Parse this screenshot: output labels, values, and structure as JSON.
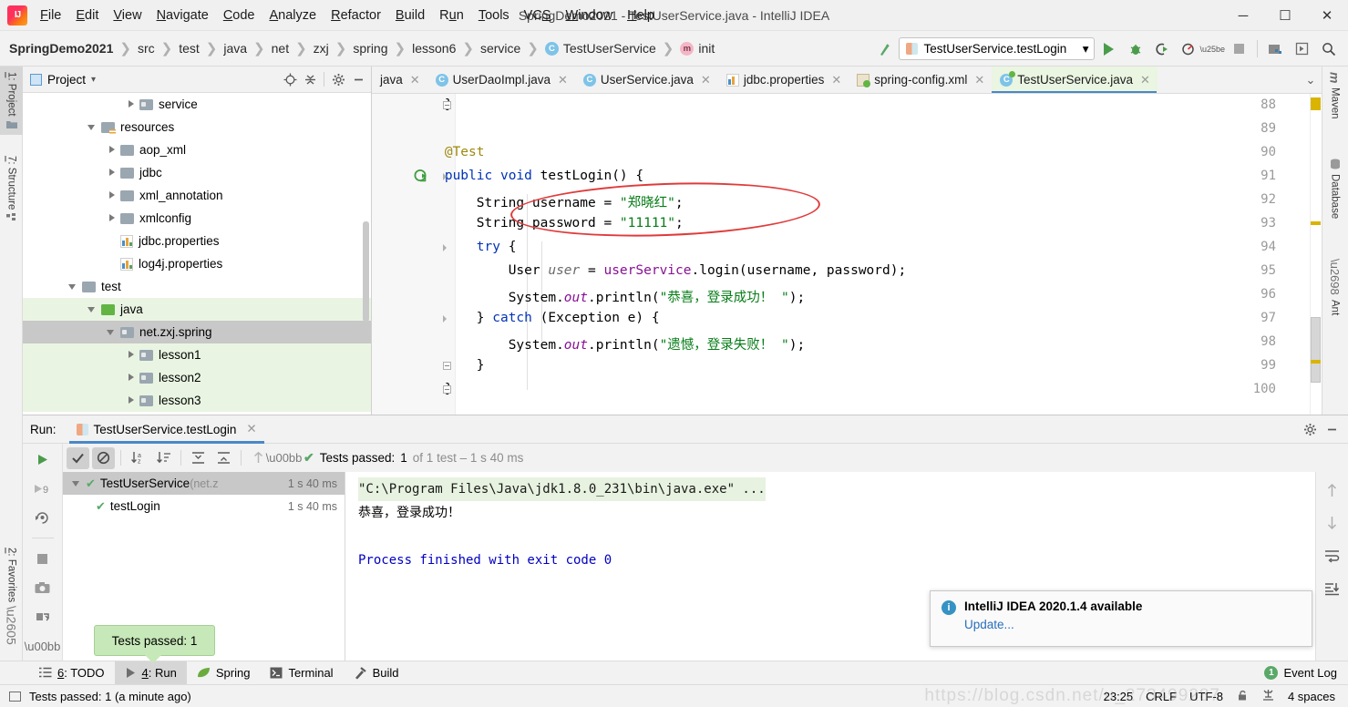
{
  "window": {
    "title": "SpringDemo2021 - TestUserService.java - IntelliJ IDEA",
    "minimize": "─",
    "maximize": "☐",
    "close": "✕"
  },
  "menu": [
    {
      "label": "File",
      "mnemonic": "F"
    },
    {
      "label": "Edit",
      "mnemonic": "E"
    },
    {
      "label": "View",
      "mnemonic": "V"
    },
    {
      "label": "Navigate",
      "mnemonic": "N"
    },
    {
      "label": "Code",
      "mnemonic": "C"
    },
    {
      "label": "Analyze",
      "mnemonic": "A"
    },
    {
      "label": "Refactor",
      "mnemonic": "R"
    },
    {
      "label": "Build",
      "mnemonic": "B"
    },
    {
      "label": "Run",
      "mnemonic": "u"
    },
    {
      "label": "Tools",
      "mnemonic": "T"
    },
    {
      "label": "VCS",
      "mnemonic": "S"
    },
    {
      "label": "Window",
      "mnemonic": "W"
    },
    {
      "label": "Help",
      "mnemonic": "H"
    }
  ],
  "breadcrumb": [
    {
      "label": "SpringDemo2021",
      "icon": null
    },
    {
      "label": "src",
      "icon": null
    },
    {
      "label": "test",
      "icon": null
    },
    {
      "label": "java",
      "icon": null
    },
    {
      "label": "net",
      "icon": null
    },
    {
      "label": "zxj",
      "icon": null
    },
    {
      "label": "spring",
      "icon": null
    },
    {
      "label": "lesson6",
      "icon": null
    },
    {
      "label": "service",
      "icon": null
    },
    {
      "label": "TestUserService",
      "icon": "class-icon",
      "icon_letter": "C"
    },
    {
      "label": "init",
      "icon": "method-icon",
      "icon_letter": "m"
    }
  ],
  "toolbar": {
    "run_configuration": "TestUserService.testLogin",
    "dropdown_arrow": "▾",
    "buttons": [
      {
        "name": "run-button",
        "glyph": "▶"
      },
      {
        "name": "debug-button",
        "glyph": "🐞"
      },
      {
        "name": "run-with-coverage-button",
        "glyph": "▶"
      },
      {
        "name": "profile-button",
        "glyph": "◔"
      },
      {
        "name": "stop-button",
        "glyph": "■"
      },
      {
        "name": "update-project-button",
        "glyph": "⬛"
      },
      {
        "name": "open-in-browser-button",
        "glyph": "▣"
      },
      {
        "name": "search-everywhere-button",
        "glyph": "🔍"
      }
    ]
  },
  "left_tool_tabs": [
    {
      "label": "1: Project",
      "mnemonic": "1",
      "selected": true,
      "icon": "folder-icon"
    },
    {
      "label": "7: Structure",
      "mnemonic": "7",
      "selected": false,
      "icon": "structure-icon"
    },
    {
      "label": "2: Favorites",
      "mnemonic": "2",
      "selected": false,
      "icon": "star-icon"
    }
  ],
  "right_tool_tabs": [
    {
      "label": "Maven",
      "icon": "maven-icon"
    },
    {
      "label": "Database",
      "icon": "database-icon"
    },
    {
      "label": "Ant",
      "icon": "ant-icon"
    }
  ],
  "project_panel": {
    "title": "Project",
    "dropdown": "▾",
    "actions": [
      {
        "name": "locate-file-icon",
        "glyph": "⊕"
      },
      {
        "name": "collapse-all-icon",
        "glyph": "⩵"
      },
      {
        "name": "settings-gear-icon",
        "glyph": "⚙"
      },
      {
        "name": "hide-panel-icon",
        "glyph": "─"
      }
    ],
    "tree": [
      {
        "label": "service",
        "indent": 5,
        "arrow": "closed",
        "icon": "package-folder",
        "hl": "none"
      },
      {
        "label": "resources",
        "indent": 3,
        "arrow": "open",
        "icon": "resources-folder",
        "hl": "none"
      },
      {
        "label": "aop_xml",
        "indent": 4,
        "arrow": "closed",
        "icon": "folder",
        "hl": "none"
      },
      {
        "label": "jdbc",
        "indent": 4,
        "arrow": "closed",
        "icon": "folder",
        "hl": "none"
      },
      {
        "label": "xml_annotation",
        "indent": 4,
        "arrow": "closed",
        "icon": "folder",
        "hl": "none"
      },
      {
        "label": "xmlconfig",
        "indent": 4,
        "arrow": "closed",
        "icon": "folder",
        "hl": "none"
      },
      {
        "label": "jdbc.properties",
        "indent": 4,
        "arrow": "none",
        "icon": "properties-file",
        "hl": "none"
      },
      {
        "label": "log4j.properties",
        "indent": 4,
        "arrow": "none",
        "icon": "properties-file",
        "hl": "none"
      },
      {
        "label": "test",
        "indent": 2,
        "arrow": "open",
        "icon": "folder",
        "hl": "none"
      },
      {
        "label": "java",
        "indent": 3,
        "arrow": "open",
        "icon": "source-folder-green",
        "hl": "green"
      },
      {
        "label": "net.zxj.spring",
        "indent": 4,
        "arrow": "open",
        "icon": "package-folder",
        "hl": "selected"
      },
      {
        "label": "lesson1",
        "indent": 5,
        "arrow": "closed",
        "icon": "package-folder",
        "hl": "green"
      },
      {
        "label": "lesson2",
        "indent": 5,
        "arrow": "closed",
        "icon": "package-folder",
        "hl": "green"
      },
      {
        "label": "lesson3",
        "indent": 5,
        "arrow": "closed",
        "icon": "package-folder",
        "hl": "green"
      }
    ]
  },
  "editor_tabs": [
    {
      "label": "java",
      "icon": "file-icon",
      "active": false,
      "close": "✕"
    },
    {
      "label": "UserDaoImpl.java",
      "icon": "class-icon",
      "active": false,
      "close": "✕"
    },
    {
      "label": "UserService.java",
      "icon": "class-icon",
      "active": false,
      "close": "✕"
    },
    {
      "label": "jdbc.properties",
      "icon": "properties-icon",
      "active": false,
      "close": "✕"
    },
    {
      "label": "spring-config.xml",
      "icon": "xml-icon",
      "active": false,
      "close": "✕"
    },
    {
      "label": "TestUserService.java",
      "icon": "test-class-icon",
      "active": true,
      "close": "✕"
    }
  ],
  "editor_tabs_overflow": "⌄",
  "code": {
    "first_line": 88,
    "lines": [
      {
        "num": 88,
        "indent": 2,
        "tokens": [
          {
            "t": "}",
            "c": "p"
          }
        ]
      },
      {
        "num": 89,
        "indent": 0,
        "tokens": []
      },
      {
        "num": 90,
        "indent": 2,
        "tokens": [
          {
            "t": "@Test",
            "c": "an"
          }
        ]
      },
      {
        "num": 91,
        "indent": 2,
        "tokens": [
          {
            "t": "public",
            "c": "k"
          },
          {
            "t": " ",
            "c": "p"
          },
          {
            "t": "void",
            "c": "k"
          },
          {
            "t": " testLogin() {",
            "c": "p"
          }
        ]
      },
      {
        "num": 92,
        "indent": 3,
        "tokens": [
          {
            "t": "String username = ",
            "c": "p"
          },
          {
            "t": "\"郑晓红\"",
            "c": "s"
          },
          {
            "t": ";",
            "c": "p"
          }
        ]
      },
      {
        "num": 93,
        "indent": 3,
        "tokens": [
          {
            "t": "String password = ",
            "c": "p"
          },
          {
            "t": "\"11111\"",
            "c": "s"
          },
          {
            "t": ";",
            "c": "p"
          }
        ]
      },
      {
        "num": 94,
        "indent": 3,
        "tokens": [
          {
            "t": "try",
            "c": "k"
          },
          {
            "t": " {",
            "c": "p"
          }
        ]
      },
      {
        "num": 95,
        "indent": 4,
        "tokens": [
          {
            "t": "User ",
            "c": "p"
          },
          {
            "t": "user",
            "c": "lv"
          },
          {
            "t": " = ",
            "c": "p"
          },
          {
            "t": "userService",
            "c": "f"
          },
          {
            "t": ".login(username, password);",
            "c": "p"
          }
        ]
      },
      {
        "num": 96,
        "indent": 4,
        "tokens": [
          {
            "t": "System.",
            "c": "p"
          },
          {
            "t": "out",
            "c": "fld"
          },
          {
            "t": ".println(",
            "c": "p"
          },
          {
            "t": "\"恭喜，登录成功！ \"",
            "c": "s"
          },
          {
            "t": ");",
            "c": "p"
          }
        ]
      },
      {
        "num": 97,
        "indent": 3,
        "tokens": [
          {
            "t": "} ",
            "c": "p"
          },
          {
            "t": "catch",
            "c": "k"
          },
          {
            "t": " (Exception e) {",
            "c": "p"
          }
        ]
      },
      {
        "num": 98,
        "indent": 4,
        "tokens": [
          {
            "t": "System.",
            "c": "p"
          },
          {
            "t": "out",
            "c": "fld"
          },
          {
            "t": ".println(",
            "c": "p"
          },
          {
            "t": "\"遗憾，登录失败！ \"",
            "c": "s"
          },
          {
            "t": ");",
            "c": "p"
          }
        ]
      },
      {
        "num": 99,
        "indent": 3,
        "tokens": [
          {
            "t": "}",
            "c": "p"
          }
        ]
      },
      {
        "num": 100,
        "indent": 2,
        "tokens": [
          {
            "t": "}",
            "c": "p"
          }
        ]
      }
    ],
    "annotation": {
      "type": "red-ellipse",
      "covers_lines": [
        92,
        93
      ]
    }
  },
  "run_window": {
    "label": "Run:",
    "tab": "TestUserService.testLogin",
    "tab_close": "✕",
    "header_actions": [
      {
        "name": "settings-gear-icon",
        "glyph": "⚙"
      },
      {
        "name": "hide-panel-icon",
        "glyph": "─"
      }
    ],
    "gutter_buttons": [
      {
        "name": "rerun-button",
        "glyph": "▶"
      },
      {
        "name": "rerun-failed-tests-button",
        "glyph": "▶9"
      },
      {
        "name": "toggle-auto-test-button",
        "glyph": "↺"
      },
      {
        "name": "stop-button",
        "glyph": "■"
      },
      {
        "name": "export-test-results-button",
        "glyph": "📷"
      },
      {
        "name": "import-test-results-button",
        "glyph": "⚙"
      },
      {
        "name": "more-actions-button",
        "glyph": "»"
      }
    ],
    "test_toolbar": [
      {
        "name": "show-passed-toggle",
        "glyph": "✓",
        "on": true
      },
      {
        "name": "show-ignored-toggle",
        "glyph": "⊘",
        "on": true
      },
      {
        "name": "sort-alphabetically-button",
        "glyph": "↓a₂",
        "on": false
      },
      {
        "name": "sort-by-duration-button",
        "glyph": "↓≡",
        "on": false
      },
      {
        "name": "expand-all-button",
        "glyph": "⤒",
        "on": false
      },
      {
        "name": "collapse-all-button",
        "glyph": "⤓",
        "on": false
      },
      {
        "name": "previous-occurrence-button",
        "glyph": "↑",
        "on": false
      },
      {
        "name": "more-button",
        "glyph": "»",
        "on": false
      }
    ],
    "status": {
      "check": "✔",
      "label": "Tests passed:",
      "count": "1",
      "detail": "of 1 test – 1 s 40 ms"
    },
    "test_tree": [
      {
        "label": "TestUserService",
        "package": "(net.z",
        "time": "1 s 40 ms",
        "indent": 0,
        "selected": true,
        "arrow": "open"
      },
      {
        "label": "testLogin",
        "package": "",
        "time": "1 s 40 ms",
        "indent": 1,
        "selected": false,
        "arrow": "none"
      }
    ],
    "console": [
      {
        "text": "\"C:\\Program Files\\Java\\jdk1.8.0_231\\bin\\java.exe\" ...",
        "style": "cmd"
      },
      {
        "text": "恭喜，登录成功！",
        "style": "plain"
      },
      {
        "text": "",
        "style": "plain"
      },
      {
        "text": "Process finished with exit code 0",
        "style": "exit"
      }
    ],
    "console_side_buttons": [
      {
        "name": "scroll-up-button",
        "glyph": "↑"
      },
      {
        "name": "scroll-down-button",
        "glyph": "↓"
      },
      {
        "name": "soft-wrap-button",
        "glyph": "↵"
      },
      {
        "name": "scroll-to-end-button",
        "glyph": "⤓"
      }
    ]
  },
  "notification": {
    "icon": "info-icon",
    "title": "IntelliJ IDEA 2020.1.4 available",
    "link": "Update..."
  },
  "tooltip": {
    "text": "Tests passed: 1"
  },
  "bottom_tabs": [
    {
      "label": "6: TODO",
      "mnemonic": "6",
      "icon": "todo-icon",
      "selected": false
    },
    {
      "label": "4: Run",
      "mnemonic": "4",
      "icon": "run-icon",
      "selected": true
    },
    {
      "label": "Spring",
      "mnemonic": "",
      "icon": "spring-leaf-icon",
      "selected": false
    },
    {
      "label": "Terminal",
      "mnemonic": "",
      "icon": "terminal-icon",
      "selected": false
    },
    {
      "label": "Build",
      "mnemonic": "",
      "icon": "hammer-icon",
      "selected": false
    }
  ],
  "event_log": {
    "badge": "1",
    "label": "Event Log"
  },
  "statusbar": {
    "message": "Tests passed: 1 (a minute ago)",
    "time": "23:25",
    "line_separator": "CRLF",
    "encoding": "UTF-8",
    "lock_icon": "🔓",
    "branch_icon": "⚒",
    "indent": "4 spaces",
    "watermark": "https://blog.csdn.net/u_273499287"
  }
}
